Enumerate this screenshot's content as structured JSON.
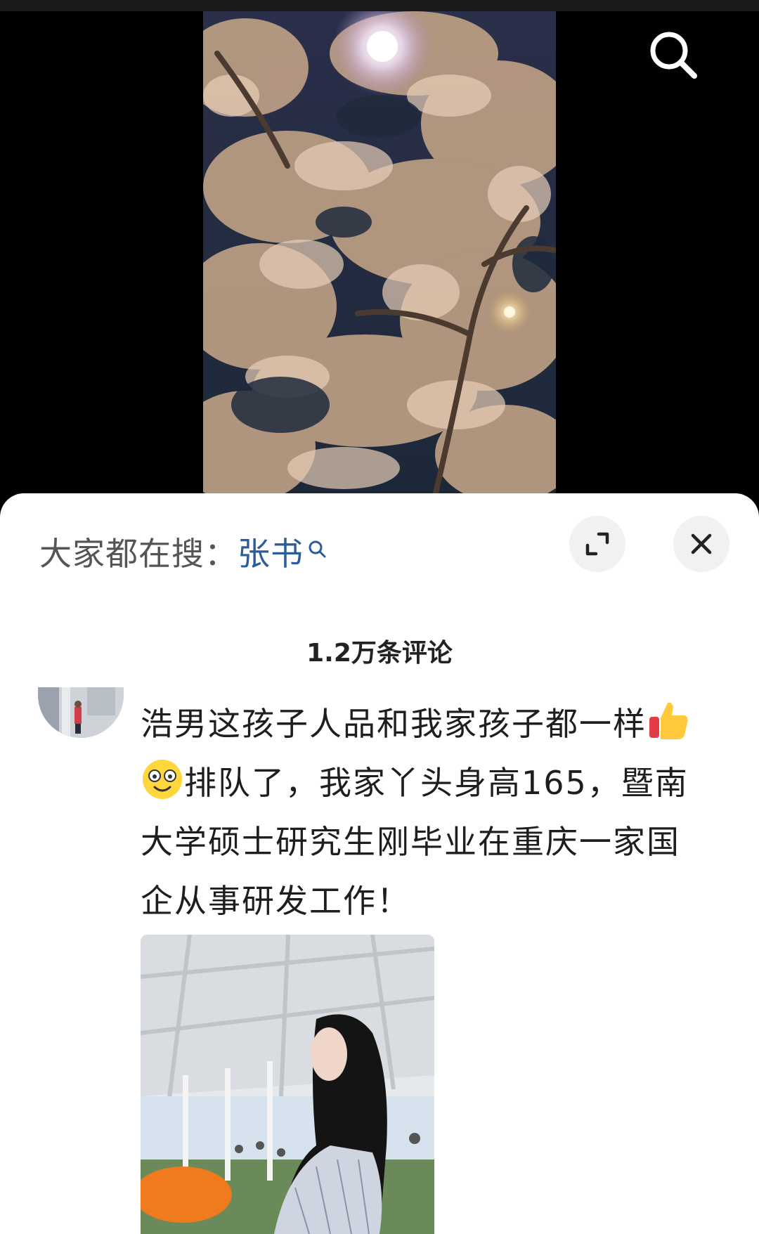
{
  "header": {
    "search_icon": "search-icon"
  },
  "video": {
    "description_icon": "video-thumbnail"
  },
  "sheet": {
    "trending_prefix": "大家都在搜：",
    "trending_term": "张书",
    "expand_icon": "expand-icon",
    "close_icon": "close-icon",
    "comment_count": "1.2万条评论"
  },
  "comments": [
    {
      "text_part1": "浩男这孩子人品和我家孩子都一样",
      "emoji1": "thumbs-up-emoji",
      "emoji2": "smile-emoji",
      "text_part2": "排队了，我家丫头身高165，暨南大学硕士研究生刚毕业在重庆一家国企从事研发工作！"
    }
  ],
  "colors": {
    "link": "#2b5c9c",
    "text": "#1e1e1e",
    "muted": "#555555",
    "button_bg": "#f1f1f1"
  }
}
